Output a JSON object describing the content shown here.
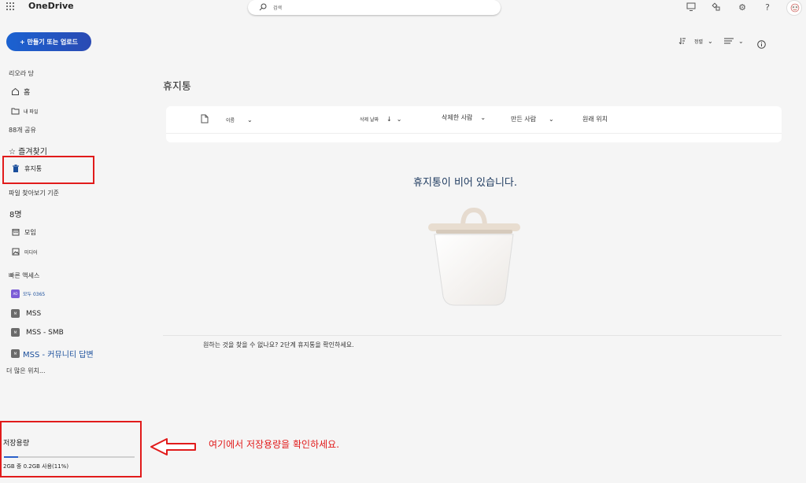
{
  "app": {
    "title": "OneDrive"
  },
  "search": {
    "placeholder": "검색"
  },
  "create_button": {
    "label": "+ 만들기 또는 업로드"
  },
  "toolbar": {
    "sort_label": "정렬"
  },
  "sidebar": {
    "user_section": "리오라 당",
    "home": "홈",
    "my_files": "내 파일",
    "shared": "88개 공유",
    "favorites": "☆ 즐겨찾기",
    "recycle_bin": "휴지통",
    "browse_section": "파일 찾아보기 기준",
    "people": "8명",
    "meetings": "모임",
    "media": "미디어",
    "quick_access": "빠른 액세스",
    "items": [
      {
        "badge": "AO",
        "label": "모두 0365",
        "color": "#7b5cd6"
      },
      {
        "badge": "M",
        "label": "MSS",
        "color": "#6b6b6b"
      },
      {
        "badge": "M",
        "label": "MSS - SMB",
        "color": "#6b6b6b"
      },
      {
        "badge": "M",
        "label": "MSS - 커뮤니티 답변",
        "color": "#6b6b6b"
      }
    ],
    "more": "더 많은 위치..."
  },
  "main": {
    "title": "휴지통",
    "columns": {
      "name": "이름",
      "deleted_date": "삭제 날짜",
      "deleted_by": "삭제한 사람",
      "created_by": "만든 사람",
      "original_location": "원래 위치"
    },
    "empty_message": "휴지통이 비어 있습니다.",
    "hint": "원하는 것을 찾을 수 없나요? 2단계 휴지통을 확인하세요."
  },
  "storage": {
    "title": "저장용량",
    "usage_text": "2GB 중 0.2GB 사용(11%)",
    "percent": 11
  },
  "annotation": {
    "text": "여기에서 저장용량을 확인하세요.",
    "color": "#e11b1b"
  },
  "colors": {
    "accent": "#1b62d1",
    "recycle": "#1b4f9c"
  }
}
